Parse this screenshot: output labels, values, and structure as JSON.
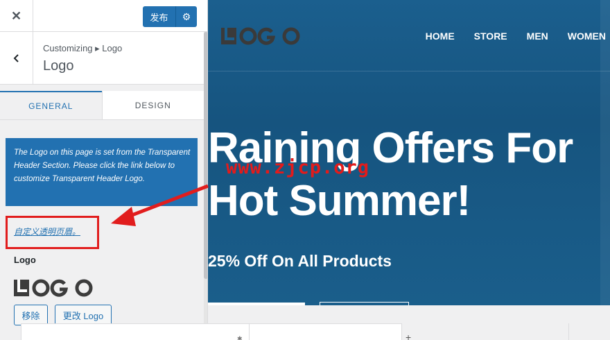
{
  "topbar": {
    "close_glyph": "✕",
    "publish_label": "发布",
    "gear_glyph": "⚙"
  },
  "section": {
    "breadcrumb": "Customizing ▸ Logo",
    "title": "Logo"
  },
  "tabs": [
    {
      "label": "GENERAL",
      "active": true
    },
    {
      "label": "DESIGN",
      "active": false
    }
  ],
  "notice": {
    "text": "The Logo on this page is set from the Transparent Header Section. Please click the link below to customize Transparent Header Logo."
  },
  "custom_link": "自定义透明页眉。",
  "logo_control": {
    "label": "Logo",
    "remove_label": "移除",
    "change_label": "更改 Logo"
  },
  "site": {
    "nav": [
      "HOME",
      "STORE",
      "MEN",
      "WOMEN"
    ],
    "hero_title_line1": "Raining Offers For",
    "hero_title_line2": "Hot Summer!",
    "hero_subtitle": "25% Off On All Products",
    "watermark": "www.zjcp.org"
  },
  "colors": {
    "accent": "#2271b1",
    "hero_bg": "#1b5f8e",
    "annotation_red": "#e11d1d"
  },
  "icons": {
    "close": "close-icon",
    "gear": "gear-icon",
    "back": "chevron-left-icon"
  }
}
